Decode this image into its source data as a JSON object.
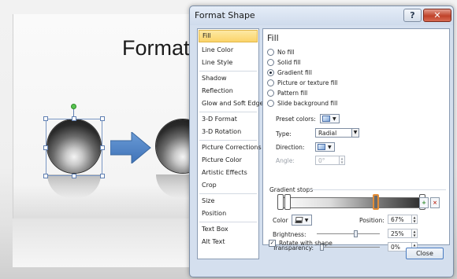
{
  "slide": {
    "title": "Format s"
  },
  "dialog": {
    "title": "Format Shape",
    "help_label": "?",
    "close_x": "✕",
    "close_button": "Close"
  },
  "nav": {
    "items": [
      {
        "label": "Fill",
        "selected": true
      },
      {
        "label": "Line Color"
      },
      {
        "label": "Line Style"
      },
      {
        "label": "Shadow"
      },
      {
        "label": "Reflection"
      },
      {
        "label": "Glow and Soft Edges"
      },
      {
        "label": "3-D Format"
      },
      {
        "label": "3-D Rotation"
      },
      {
        "label": "Picture Corrections"
      },
      {
        "label": "Picture Color"
      },
      {
        "label": "Artistic Effects"
      },
      {
        "label": "Crop"
      },
      {
        "label": "Size"
      },
      {
        "label": "Position"
      },
      {
        "label": "Text Box"
      },
      {
        "label": "Alt Text"
      }
    ]
  },
  "fill": {
    "heading": "Fill",
    "options": [
      {
        "label": "No fill",
        "checked": false
      },
      {
        "label": "Solid fill",
        "checked": false
      },
      {
        "label": "Gradient fill",
        "checked": true
      },
      {
        "label": "Picture or texture fill",
        "checked": false
      },
      {
        "label": "Pattern fill",
        "checked": false
      },
      {
        "label": "Slide background fill",
        "checked": false
      }
    ],
    "preset_colors_label": "Preset colors:",
    "type_label": "Type:",
    "type_value": "Radial",
    "direction_label": "Direction:",
    "angle_label": "Angle:",
    "angle_value": "0°",
    "gradient_stops_label": "Gradient stops",
    "stop_positions": [
      0,
      0.06,
      0.67,
      1
    ],
    "selected_stop": 2,
    "color_label": "Color",
    "position_label": "Position:",
    "position_value": "67%",
    "brightness_label": "Brightness:",
    "brightness_value": "25%",
    "brightness_level": 0.625,
    "transparency_label": "Transparency:",
    "transparency_value": "0%",
    "transparency_level": 0,
    "rotate_with_shape_label": "Rotate with shape",
    "rotate_with_shape_checked": true
  }
}
